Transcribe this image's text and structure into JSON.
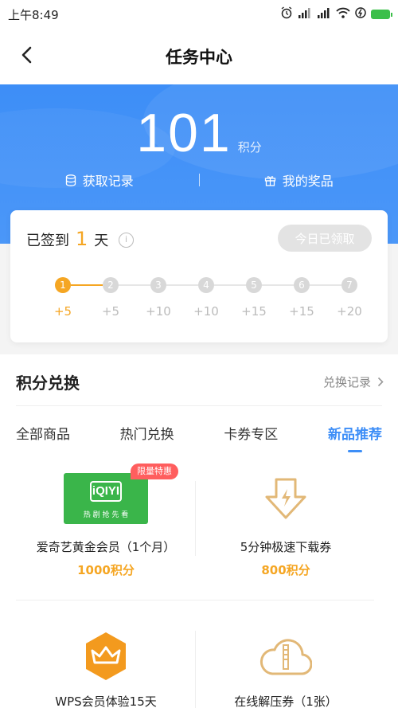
{
  "status": {
    "time": "上午8:49"
  },
  "nav": {
    "title": "任务中心"
  },
  "points": {
    "value": "101",
    "unit": "积分"
  },
  "hero_links": [
    {
      "label": "获取记录",
      "icon": "database-icon"
    },
    {
      "label": "我的奖品",
      "icon": "gift-icon"
    }
  ],
  "signin": {
    "prefix": "已签到",
    "days": "1",
    "suffix": "天",
    "button": "今日已领取",
    "steps": [
      {
        "day": "1",
        "reward": "+5",
        "active": true
      },
      {
        "day": "2",
        "reward": "+5",
        "active": false
      },
      {
        "day": "3",
        "reward": "+10",
        "active": false
      },
      {
        "day": "4",
        "reward": "+10",
        "active": false
      },
      {
        "day": "5",
        "reward": "+15",
        "active": false
      },
      {
        "day": "6",
        "reward": "+15",
        "active": false
      },
      {
        "day": "7",
        "reward": "+20",
        "active": false
      }
    ]
  },
  "exchange": {
    "title": "积分兑换",
    "record": "兑换记录",
    "tabs": [
      "全部商品",
      "热门兑换",
      "卡券专区",
      "新品推荐"
    ],
    "active_tab": 3,
    "products": [
      {
        "name": "爱奇艺黄金会员（1个月）",
        "price": "1000积分",
        "badge": "限量特惠",
        "logo_text": "iQIYI",
        "slogan": "热 剧 抢 先 看"
      },
      {
        "name": "5分钟极速下载券",
        "price": "800积分"
      },
      {
        "name": "WPS会员体验15天"
      },
      {
        "name": "在线解压券（1张）"
      }
    ]
  },
  "colors": {
    "accent": "#3d8ef7",
    "orange": "#f5a623",
    "badge": "#ff5e5e",
    "iqiyi": "#3ab54a",
    "wps": "#f39a1e"
  }
}
